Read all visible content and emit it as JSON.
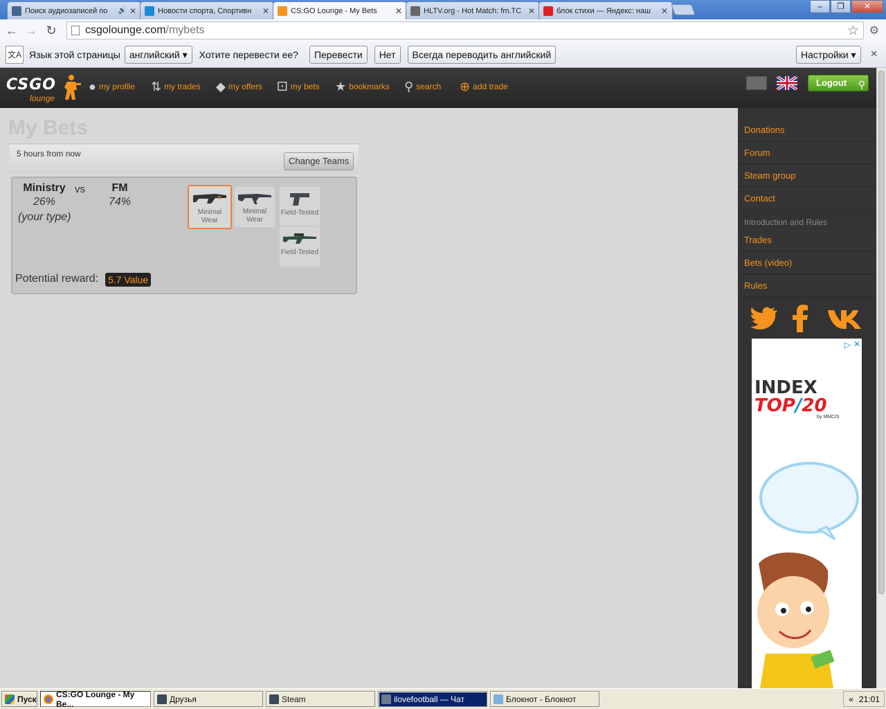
{
  "browser": {
    "tabs": [
      {
        "title": "Поиск аудиозаписей по",
        "fav_color": "#45668e"
      },
      {
        "title": "Новости спорта, Спортивн",
        "fav_color": "#1b8ad8"
      },
      {
        "title": "CS:GO Lounge - My Bets",
        "fav_color": "#f7941d"
      },
      {
        "title": "HLTV.org - Hot Match: fm.TC",
        "fav_color": "#666666"
      },
      {
        "title": "блок стихи — Яндекс: наш",
        "fav_color": "#e31e24"
      }
    ],
    "url_host": "csgolounge.com",
    "url_path": "/mybets"
  },
  "translate": {
    "language_label": "Язык этой страницы",
    "language_value": "английский",
    "question": "Хотите перевести ее?",
    "translate_btn": "Перевести",
    "no_btn": "Нет",
    "always_btn": "Всегда переводить английский",
    "settings_btn": "Настройки"
  },
  "site": {
    "logo_main": "CSGO",
    "logo_sub": "lounge",
    "nav": {
      "profile": "my profile",
      "trades": "my trades",
      "offers": "my offers",
      "bets": "my bets",
      "bookmarks": "bookmarks",
      "search": "search",
      "add_trade": "add trade"
    },
    "logout": "Logout"
  },
  "main": {
    "title": "My Bets",
    "time": "5 hours from now",
    "change_teams": "Change Teams",
    "team1": {
      "name": "Ministry",
      "pct": "26%",
      "note": "(your type)"
    },
    "vs": "vs",
    "team2": {
      "name": "FM",
      "pct": "74%"
    },
    "items": [
      {
        "cond1": "Minimal",
        "cond2": "Wear"
      },
      {
        "cond1": "Minimal",
        "cond2": "Wear"
      },
      {
        "cond1": "Field-Tested",
        "cond2": ""
      },
      {
        "cond1": "Field-Tested",
        "cond2": ""
      }
    ],
    "reward_label": "Potential reward:",
    "reward_value": "5.7 Value"
  },
  "sidebar": {
    "links1": [
      "Donations",
      "Forum",
      "Steam group",
      "Contact"
    ],
    "section_heading": "Introduction and Rules",
    "links2": [
      "Trades",
      "Bets (video)",
      "Rules"
    ],
    "ad": {
      "line1": "INDEX",
      "line2": "TOP",
      "line3": "20",
      "brand": "by MMCIS"
    }
  },
  "taskbar": {
    "start": "Пуск",
    "items": [
      "CS:GO Lounge - My Be...",
      "Друзья",
      "Steam",
      "ilovefootball — Чат",
      "Блокнот - Блокнот"
    ],
    "clock": "21:01"
  },
  "colors": {
    "accent": "#f7941d",
    "header_bg": "#2e2e2e",
    "logout_green": "#5fae28"
  }
}
